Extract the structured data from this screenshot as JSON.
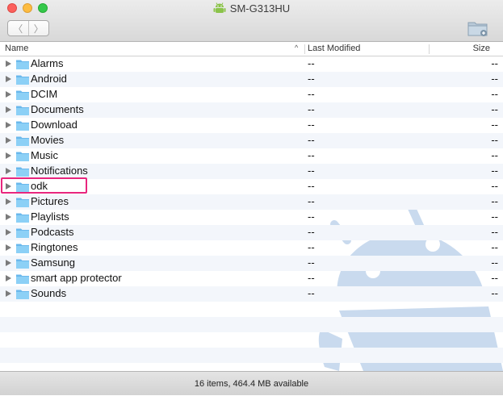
{
  "window": {
    "title": "SM-G313HU"
  },
  "toolbar": {
    "back_icon": "chevron-left-icon",
    "forward_icon": "chevron-right-icon",
    "back_glyph": "〈",
    "forward_glyph": "〉",
    "new_folder_icon": "new-folder-icon"
  },
  "columns": {
    "name": "Name",
    "modified": "Last Modified",
    "size": "Size"
  },
  "files": [
    {
      "name": "Alarms",
      "modified": "--",
      "size": "--"
    },
    {
      "name": "Android",
      "modified": "--",
      "size": "--"
    },
    {
      "name": "DCIM",
      "modified": "--",
      "size": "--"
    },
    {
      "name": "Documents",
      "modified": "--",
      "size": "--"
    },
    {
      "name": "Download",
      "modified": "--",
      "size": "--"
    },
    {
      "name": "Movies",
      "modified": "--",
      "size": "--"
    },
    {
      "name": "Music",
      "modified": "--",
      "size": "--"
    },
    {
      "name": "Notifications",
      "modified": "--",
      "size": "--"
    },
    {
      "name": "odk",
      "modified": "--",
      "size": "--"
    },
    {
      "name": "Pictures",
      "modified": "--",
      "size": "--"
    },
    {
      "name": "Playlists",
      "modified": "--",
      "size": "--"
    },
    {
      "name": "Podcasts",
      "modified": "--",
      "size": "--"
    },
    {
      "name": "Ringtones",
      "modified": "--",
      "size": "--"
    },
    {
      "name": "Samsung",
      "modified": "--",
      "size": "--"
    },
    {
      "name": "smart app protector",
      "modified": "--",
      "size": "--"
    },
    {
      "name": "Sounds",
      "modified": "--",
      "size": "--"
    }
  ],
  "status": {
    "text": "16 items, 464.4 MB available"
  },
  "colors": {
    "folder": "#7cc3ef",
    "highlight": "#e8267e",
    "android_watermark": "#c9daee",
    "android_green": "#8bc34a"
  }
}
